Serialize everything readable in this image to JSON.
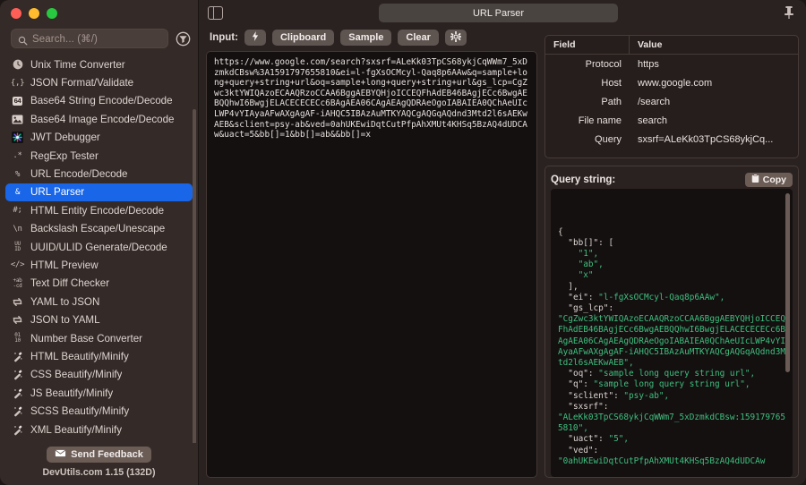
{
  "window": {
    "title": "URL Parser",
    "pin_icon": "pin-icon",
    "sidebar_toggle_icon": "sidebar-toggle-icon"
  },
  "sidebar": {
    "search": {
      "placeholder": "Search... (⌘/)",
      "value": "",
      "icon": "search-icon",
      "filter_icon": "filter-icon"
    },
    "items": [
      {
        "icon": "clock-icon",
        "glyph": "🕐",
        "label": "Unix Time Converter",
        "selected": false
      },
      {
        "icon": "json-braces-icon",
        "glyph": "{,}",
        "label": "JSON Format/Validate",
        "selected": false
      },
      {
        "icon": "base64-badge-icon",
        "glyph": "64",
        "label": "Base64 String Encode/Decode",
        "selected": false
      },
      {
        "icon": "image-icon",
        "glyph": "🖼",
        "label": "Base64 Image Encode/Decode",
        "selected": false
      },
      {
        "icon": "jwt-icon",
        "glyph": "✳",
        "label": "JWT Debugger",
        "selected": false
      },
      {
        "icon": "regex-asterisk-icon",
        "glyph": ".*",
        "label": "RegExp Tester",
        "selected": false
      },
      {
        "icon": "percent-icon",
        "glyph": "%",
        "label": "URL Encode/Decode",
        "selected": false
      },
      {
        "icon": "ampersand-icon",
        "glyph": "&",
        "label": "URL Parser",
        "selected": true
      },
      {
        "icon": "hash-semicolon-icon",
        "glyph": "#;",
        "label": "HTML Entity Encode/Decode",
        "selected": false
      },
      {
        "icon": "backslash-n-icon",
        "glyph": "\\n",
        "label": "Backslash Escape/Unescape",
        "selected": false
      },
      {
        "icon": "uuid-icon",
        "glyph": "UU ID",
        "label": "UUID/ULID Generate/Decode",
        "selected": false
      },
      {
        "icon": "code-tag-icon",
        "glyph": "</>",
        "label": "HTML Preview",
        "selected": false
      },
      {
        "icon": "text-diff-icon",
        "glyph": "+ab -cd",
        "label": "Text Diff Checker",
        "selected": false
      },
      {
        "icon": "swap-arrows-icon",
        "glyph": "⇄",
        "label": "YAML to JSON",
        "selected": false
      },
      {
        "icon": "swap-arrows-icon",
        "glyph": "⇄",
        "label": "JSON to YAML",
        "selected": false
      },
      {
        "icon": "binary-icon",
        "glyph": "01 10",
        "label": "Number Base Converter",
        "selected": false
      },
      {
        "icon": "magic-wand-icon",
        "glyph": "🪄",
        "label": "HTML Beautify/Minify",
        "selected": false
      },
      {
        "icon": "magic-wand-icon",
        "glyph": "🪄",
        "label": "CSS Beautify/Minify",
        "selected": false
      },
      {
        "icon": "magic-wand-icon",
        "glyph": "🪄",
        "label": "JS Beautify/Minify",
        "selected": false
      },
      {
        "icon": "magic-wand-icon",
        "glyph": "🪄",
        "label": "SCSS Beautify/Minify",
        "selected": false
      },
      {
        "icon": "magic-wand-icon",
        "glyph": "🪄",
        "label": "XML Beautify/Minify",
        "selected": false
      }
    ],
    "footer": {
      "feedback_label": "Send Feedback",
      "feedback_icon": "envelope-icon",
      "version": "DevUtils.com 1.15 (132D)"
    }
  },
  "input_toolbar": {
    "label": "Input:",
    "buttons": [
      {
        "name": "auto-detect-button",
        "label": "",
        "icon": "lightning-bolt-icon"
      },
      {
        "name": "clipboard-button",
        "label": "Clipboard",
        "icon": ""
      },
      {
        "name": "sample-button",
        "label": "Sample",
        "icon": ""
      },
      {
        "name": "clear-button",
        "label": "Clear",
        "icon": ""
      },
      {
        "name": "settings-button",
        "label": "",
        "icon": "gear-icon"
      }
    ]
  },
  "input": {
    "value": "https://www.google.com/search?sxsrf=ALeKk03TpCS68ykjCqWWm7_5xDzmkdCBsw%3A1591797655810&ei=l-fgXsOCMcyl-Qaq8p6AAw&q=sample+long+query+string+url&oq=sample+long+query+string+url&gs_lcp=CgZwc3ktYWIQAzoECAAQRzoCCAA6BggAEBYQHjoICCEQFhAdEB46BAgjECc6BwgAEBQQhwI6BwgjELACECECECc6BAgAEA06CAgAEAgQDRAeOgoIABAIEA0QChAeUIcLWP4vYIAyaAFwAXgAgAF-iAHQC5IBAzAuMTKYAQCgAQGqAQdnd3Mtd2l6sAEKwAEB&sclient=psy-ab&ved=0ahUKEwiDqtCutPfpAhXMUt4KHSq5BzAQ4dUDCAw&uact=5&bb[]=1&bb[]=ab&&bb[]=x"
  },
  "field_table": {
    "headers": [
      "Field",
      "Value"
    ],
    "rows": [
      {
        "field": "Protocol",
        "value": "https"
      },
      {
        "field": "Host",
        "value": "www.google.com"
      },
      {
        "field": "Path",
        "value": "/search"
      },
      {
        "field": "File name",
        "value": "search"
      },
      {
        "field": "Query",
        "value": "sxsrf=ALeKk03TpCS68ykjCq..."
      }
    ]
  },
  "query_string": {
    "title": "Query string:",
    "copy_label": "Copy",
    "copy_icon": "clipboard-icon",
    "json_lines": [
      {
        "key": "{",
        "value": null,
        "indent": 0
      },
      {
        "key": "\"bb[]\": [",
        "value": null,
        "indent": 1
      },
      {
        "key": null,
        "value": "\"1\",",
        "indent": 2
      },
      {
        "key": null,
        "value": "\"ab\",",
        "indent": 2
      },
      {
        "key": null,
        "value": "\"x\"",
        "indent": 2
      },
      {
        "key": "],",
        "value": null,
        "indent": 1
      },
      {
        "key": "\"ei\": ",
        "value": "\"l-fgXsOCMcyl-Qaq8p6AAw\",",
        "indent": 1
      },
      {
        "key": "\"gs_lcp\": ",
        "value": null,
        "indent": 1
      },
      {
        "key": null,
        "value": "\"CgZwc3ktYWIQAzoECAAQRzoCCAA6BggAEBYQHjoICCEQFhAdEB46BAgjECc6BwgAEBQQhwI6BwgjELACECECECc6BAgAEA06CAgAEAgQDRAeOgoIABAIEA0QChAeUIcLWP4vYIAyaAFwAXgAgAF-iAHQC5IBAzAuMTKYAQCgAQGqAQdnd3Mtd2l6sAEKwAEB\",",
        "indent": 0
      },
      {
        "key": "\"oq\": ",
        "value": "\"sample long query string url\",",
        "indent": 1
      },
      {
        "key": "\"q\": ",
        "value": "\"sample long query string url\",",
        "indent": 1
      },
      {
        "key": "\"sclient\": ",
        "value": "\"psy-ab\",",
        "indent": 1
      },
      {
        "key": "\"sxsrf\": ",
        "value": null,
        "indent": 1
      },
      {
        "key": null,
        "value": "\"ALeKk03TpCS68ykjCqWWm7_5xDzmkdCBsw:1591797655810\",",
        "indent": 0
      },
      {
        "key": "\"uact\": ",
        "value": "\"5\",",
        "indent": 1
      },
      {
        "key": "\"ved\": ",
        "value": null,
        "indent": 1
      },
      {
        "key": null,
        "value": "\"0ahUKEwiDqtCutPfpAhXMUt4KHSq5BzAQ4dUDCAw",
        "indent": 0
      }
    ]
  },
  "colors": {
    "accent": "#1a66e8",
    "sidebar_bg": "#342a27",
    "main_bg": "#2a2220",
    "editor_bg": "#141010",
    "json_string": "#3fbf7f",
    "traffic_red": "#ff5f57",
    "traffic_yellow": "#febc2e",
    "traffic_green": "#28c840"
  }
}
